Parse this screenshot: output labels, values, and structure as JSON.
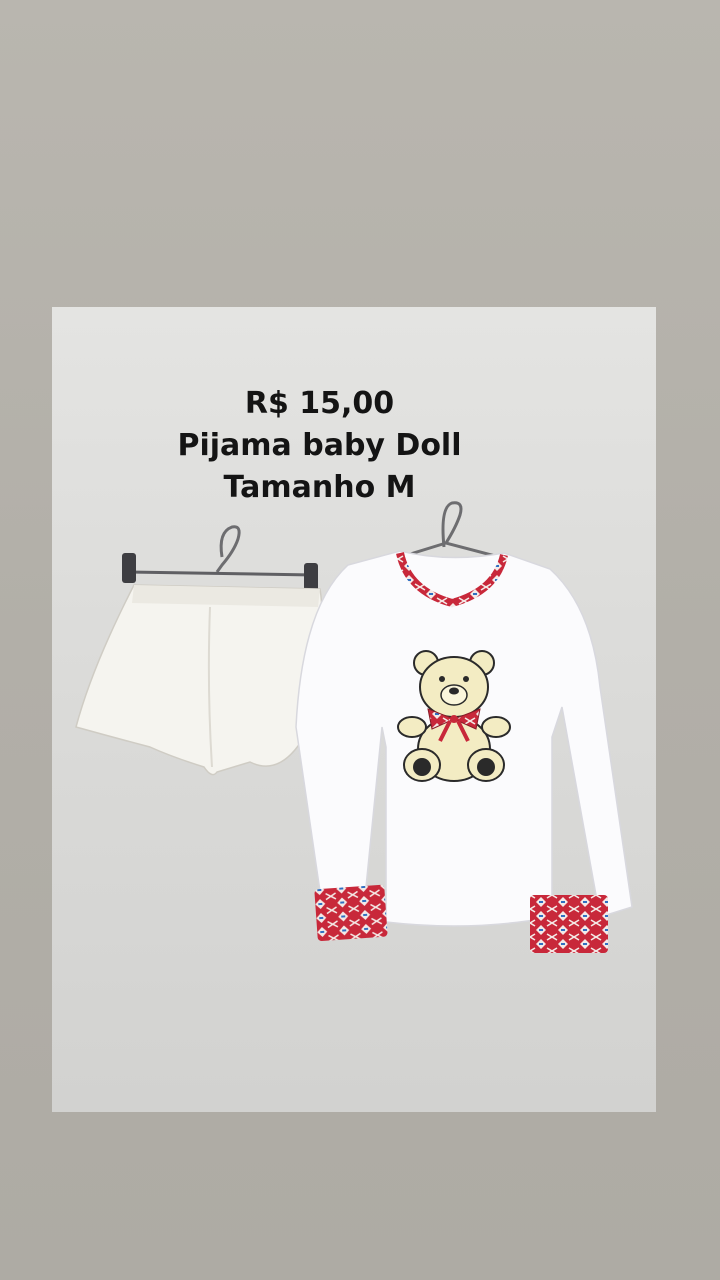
{
  "story": {
    "caption": {
      "price": "R$ 15,00",
      "product": "Pijama baby Doll",
      "size": "Tamanho M"
    }
  },
  "photo": {
    "items": [
      "shorts-on-hanger",
      "long-sleeve-shirt-on-hanger"
    ],
    "print": "teddy-bear-with-bow",
    "trim_pattern": "red-aztec-pattern"
  }
}
